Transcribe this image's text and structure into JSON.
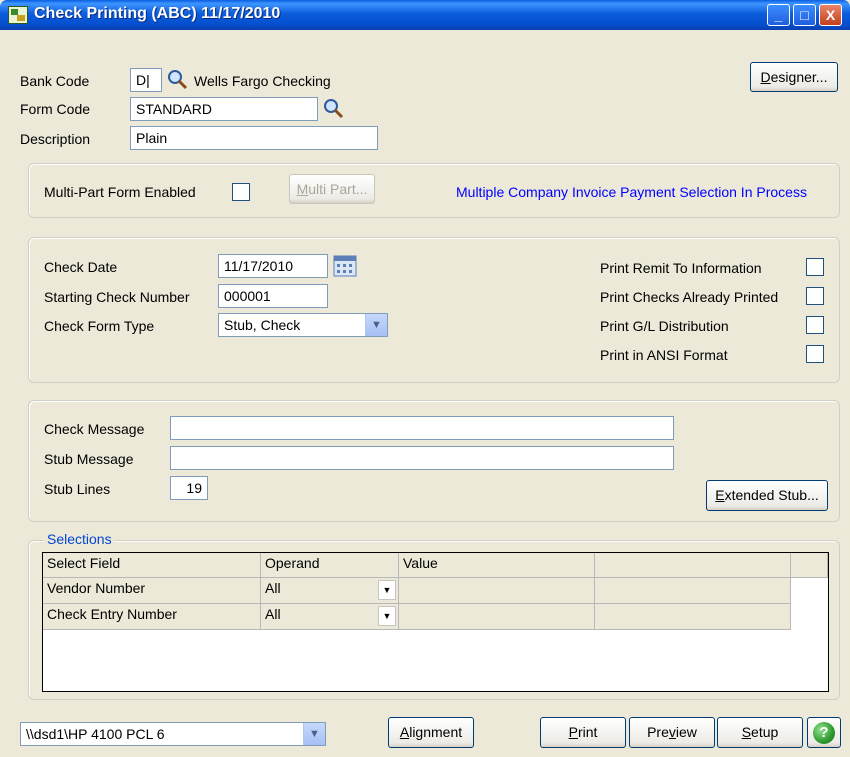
{
  "window": {
    "title": "Check Printing (ABC) 11/17/2010",
    "minimize": "_",
    "maximize": "□",
    "close": "X"
  },
  "header": {
    "bank_code_label": "Bank Code",
    "bank_code_value": "D|",
    "bank_name": "Wells Fargo Checking",
    "form_code_label": "Form Code",
    "form_code_value": "STANDARD",
    "description_label": "Description",
    "description_value": "Plain",
    "designer_prefix": "D",
    "designer_rest": "esigner..."
  },
  "multipart": {
    "label": "Multi-Part Form Enabled",
    "button_prefix": "M",
    "button_rest": "ulti Part...",
    "status_text": "Multiple Company Invoice Payment Selection In Process"
  },
  "check": {
    "date_label": "Check Date",
    "date_value": "11/17/2010",
    "start_label": "Starting Check Number",
    "start_value": "000001",
    "form_type_label": "Check Form Type",
    "form_type_value": "Stub, Check",
    "options": [
      "Print Remit To Information",
      "Print Checks Already Printed",
      "Print G/L Distribution",
      "Print in ANSI Format"
    ]
  },
  "messages": {
    "check_label": "Check Message",
    "check_value": "",
    "stub_label": "Stub Message",
    "stub_value": "",
    "lines_label": "Stub Lines",
    "lines_value": "19",
    "extended_prefix": "E",
    "extended_rest": "xtended Stub..."
  },
  "selections": {
    "legend": "Selections",
    "columns": [
      "Select Field",
      "Operand",
      "Value"
    ],
    "rows": [
      {
        "field": "Vendor Number",
        "operand": "All",
        "value": ""
      },
      {
        "field": "Check Entry Number",
        "operand": "All",
        "value": ""
      }
    ]
  },
  "footer": {
    "printer": "\\\\dsd1\\HP 4100 PCL 6",
    "alignment_prefix": "A",
    "alignment_rest": "lignment",
    "print_prefix": "P",
    "print_rest": "rint",
    "preview_a": "Pre",
    "preview_u": "v",
    "preview_b": "iew",
    "setup_prefix": "S",
    "setup_rest": "etup",
    "help": "?"
  },
  "colors": {
    "titlebar": "#0b5ddb",
    "face": "#ece9d8",
    "status_text": "#0000ff",
    "help_button": "#2e9a2e"
  }
}
